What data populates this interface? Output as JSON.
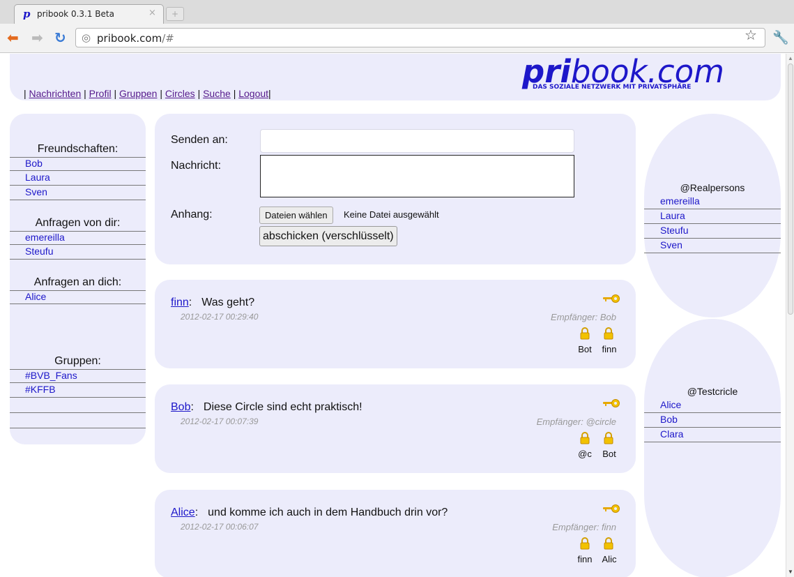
{
  "browser": {
    "tab_title": "pribook 0.3.1 Beta",
    "tab_favicon": "p",
    "tab_close": "×",
    "newtab_glyph": "+",
    "url_host": "pribook.com",
    "url_path": "/#"
  },
  "logo": {
    "main_bold": "pri",
    "main_rest": "book.com",
    "tagline": "DAS SOZIALE NETZWERK MIT PRIVATSPHÄRE"
  },
  "nav": {
    "sep": "|",
    "items": [
      "Nachrichten",
      "Profil",
      "Gruppen",
      "Circles",
      "Suche",
      "Logout"
    ]
  },
  "sidebar": {
    "friends_title": "Freundschaften:",
    "friends": [
      "Bob",
      "Laura",
      "Sven"
    ],
    "outgoing_title": "Anfragen von dir:",
    "outgoing": [
      "emereilla",
      "Steufu"
    ],
    "incoming_title": "Anfragen an dich:",
    "incoming": [
      "Alice"
    ],
    "groups_title": "Gruppen:",
    "groups": [
      "#BVB_Fans",
      "#KFFB"
    ]
  },
  "compose": {
    "to_label": "Senden an:",
    "message_label": "Nachricht:",
    "attachment_label": "Anhang:",
    "file_button": "Dateien wählen",
    "file_none": "Keine Datei ausgewählt",
    "submit": "abschicken (verschlüsselt)"
  },
  "messages": [
    {
      "author": "finn",
      "text": "Was geht?",
      "date": "2012-02-17 00:29:40",
      "recipient": "Empfänger: Bob",
      "locks": [
        "Bot",
        "finn"
      ]
    },
    {
      "author": "Bob",
      "text": "Diese Circle sind echt praktisch!",
      "date": "2012-02-17 00:07:39",
      "recipient": "Empfänger: @circle",
      "locks": [
        "@c",
        "Bot"
      ]
    },
    {
      "author": "Alice",
      "text": "und komme ich auch in dem Handbuch drin vor?",
      "date": "2012-02-17 00:06:07",
      "recipient": "Empfänger: finn",
      "locks": [
        "finn",
        "Alic"
      ]
    }
  ],
  "circles": [
    {
      "title": "@Realpersons",
      "members": [
        "emereilla",
        "Laura",
        "Steufu",
        "Sven"
      ]
    },
    {
      "title": "@Testcricle",
      "members": [
        "Alice",
        "Bob",
        "Clara"
      ]
    }
  ],
  "colors": {
    "panel": "#ececfb",
    "link": "#1d17c9",
    "visited": "#551a8b",
    "lock": "#e6a800"
  },
  "icons": [
    "back-arrow-icon",
    "forward-arrow-icon",
    "reload-icon",
    "globe-icon",
    "star-icon",
    "wrench-icon",
    "key-icon",
    "lock-icon"
  ]
}
